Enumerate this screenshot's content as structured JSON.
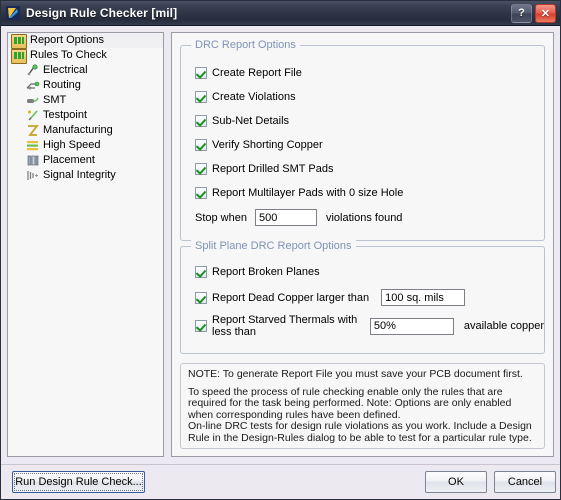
{
  "window": {
    "title": "Design Rule Checker [mil]",
    "app_icon": "altium-logo-icon",
    "help_label": "?",
    "close_label": "✕"
  },
  "tree": {
    "items": [
      {
        "label": "Report Options",
        "icon": "folder-icon",
        "level": 0,
        "selected": true
      },
      {
        "label": "Rules To Check",
        "icon": "folder-icon",
        "level": 0,
        "selected": false
      },
      {
        "label": "Electrical",
        "icon": "electrical-icon",
        "level": 1,
        "selected": false
      },
      {
        "label": "Routing",
        "icon": "routing-icon",
        "level": 1,
        "selected": false
      },
      {
        "label": "SMT",
        "icon": "smt-icon",
        "level": 1,
        "selected": false
      },
      {
        "label": "Testpoint",
        "icon": "testpoint-icon",
        "level": 1,
        "selected": false
      },
      {
        "label": "Manufacturing",
        "icon": "manufacturing-icon",
        "level": 1,
        "selected": false
      },
      {
        "label": "High Speed",
        "icon": "high-speed-icon",
        "level": 1,
        "selected": false
      },
      {
        "label": "Placement",
        "icon": "placement-icon",
        "level": 1,
        "selected": false
      },
      {
        "label": "Signal Integrity",
        "icon": "signal-integrity-icon",
        "level": 1,
        "selected": false
      }
    ]
  },
  "drc_report_options": {
    "title": "DRC Report Options",
    "checkboxes": [
      {
        "label": "Create Report File",
        "checked": true
      },
      {
        "label": "Create Violations",
        "checked": true
      },
      {
        "label": "Sub-Net Details",
        "checked": true
      },
      {
        "label": "Verify Shorting Copper",
        "checked": true
      },
      {
        "label": "Report Drilled SMT Pads",
        "checked": true
      },
      {
        "label": "Report Multilayer Pads with 0 size Hole",
        "checked": true
      }
    ],
    "stop_when_prefix": "Stop when",
    "stop_when_value": "500",
    "stop_when_suffix": "violations found"
  },
  "split_plane_options": {
    "title": "Split Plane DRC Report Options",
    "broken_planes": {
      "label": "Report Broken Planes",
      "checked": true
    },
    "dead_copper": {
      "label": "Report Dead Copper larger than",
      "checked": true,
      "value": "100 sq. mils"
    },
    "starved_thermals": {
      "label": "Report Starved Thermals with less than",
      "checked": true,
      "value": "50%",
      "suffix": "available copper"
    }
  },
  "note": {
    "line1": "NOTE: To generate Report File you must save your PCB document first.",
    "line2": "To speed the process of rule checking enable only the rules that are required for the task being performed.  Note: Options are only enabled when corresponding rules have been defined.",
    "line3": "On-line DRC tests for design rule violations as you work. Include a Design Rule in the Design-Rules dialog to be able to test for a particular rule  type."
  },
  "footer": {
    "run_label": "Run Design Rule Check...",
    "ok_label": "OK",
    "cancel_label": "Cancel"
  },
  "colors": {
    "titlebar_dark": "#2f3647",
    "group_label": "#7e93b5",
    "check_green": "#1d8f21",
    "close_red": "#d9412c",
    "panel_bg": "#f7f7f8",
    "dialog_bg": "#ece9f0"
  }
}
